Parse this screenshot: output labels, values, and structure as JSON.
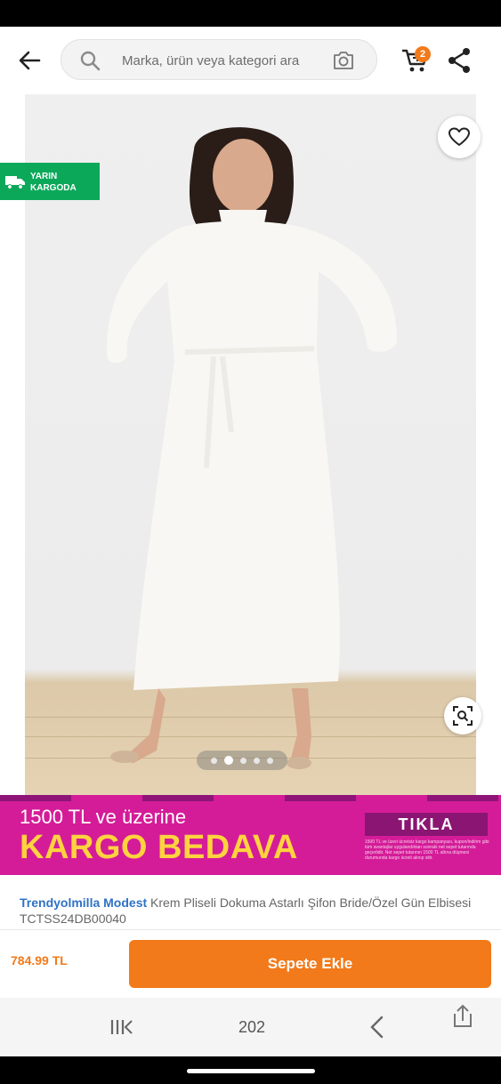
{
  "search": {
    "placeholder": "Marka, ürün veya kategori ara"
  },
  "cart": {
    "count": "2"
  },
  "badges": {
    "delivery_line1": "YARIN",
    "delivery_line2": "KARGODA"
  },
  "gallery": {
    "total_dots": 5,
    "active_index": 1
  },
  "promo": {
    "line1": "1500 TL ve üzerine",
    "line2": "KARGO BEDAVA",
    "cta": "TIKLA",
    "fine_print": "1500 TL ve üzeri ücretsiz kargo kampanyası, kupon/indirim gibi tüm avantajlar uygulandıktan sonraki net sepet tutarında geçerlidir. Net sepet tutarının 1500 TL altına düşmesi durumunda kargo ücreti alınıp sitir."
  },
  "product": {
    "brand": "Trendyolmilla Modest",
    "title": "Krem Pliseli Dokuma Astarlı Şifon Bride/Özel Gün Elbisesi TCTSS24DB00040",
    "price": "784.99 TL"
  },
  "actions": {
    "add_to_cart": "Sepete Ekle"
  },
  "browser": {
    "tab_count": "202"
  },
  "colors": {
    "accent": "#f27a1a",
    "brand_link": "#2f72c4",
    "delivery_green": "#0ca85a",
    "promo_pink": "#d41c98",
    "promo_yellow": "#ffd23f"
  }
}
